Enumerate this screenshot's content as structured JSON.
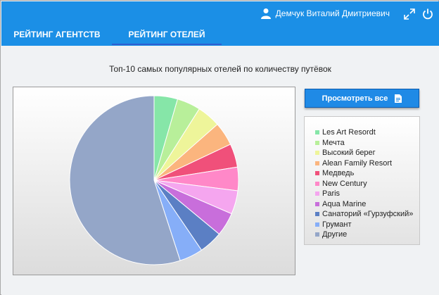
{
  "header": {
    "user_name": "Демчук Виталий Дмитриевич",
    "icons": [
      "user-icon",
      "fullscreen-icon",
      "power-icon"
    ]
  },
  "tabs": [
    {
      "label": "РЕЙТИНГ АГЕНТСТВ",
      "active": false
    },
    {
      "label": "РЕЙТИНГ ОТЕЛЕЙ",
      "active": true
    }
  ],
  "main": {
    "title": "Топ-10 самых популярных отелей по количеству путёвок",
    "view_all_label": "Просмотреть все"
  },
  "colors": {
    "header_bg": "#1b8fe6",
    "button_bg": "#1f8ae6"
  },
  "chart_data": {
    "type": "pie",
    "title": "",
    "legend_position": "right",
    "slices": [
      {
        "label": "Les Art Resordt",
        "value": 4.5,
        "color": "#86e6a8"
      },
      {
        "label": "Мечта",
        "value": 4.5,
        "color": "#b8ef9a"
      },
      {
        "label": "Высокий берег",
        "value": 4.5,
        "color": "#eef59a"
      },
      {
        "label": "Alean Family Resort",
        "value": 4.5,
        "color": "#fbb57e"
      },
      {
        "label": "Медведь",
        "value": 4.5,
        "color": "#f0507a"
      },
      {
        "label": "New Century",
        "value": 4.5,
        "color": "#ff88c8"
      },
      {
        "label": "Paris",
        "value": 4.5,
        "color": "#f5a6ef"
      },
      {
        "label": "Aqua Marine",
        "value": 4.5,
        "color": "#c86edb"
      },
      {
        "label": "Санаторий «Гурзуфский»",
        "value": 4.5,
        "color": "#5b7fc4"
      },
      {
        "label": "Грумант",
        "value": 4.5,
        "color": "#86aef8"
      },
      {
        "label": "Другие",
        "value": 55,
        "color": "#94a6c8"
      }
    ]
  }
}
